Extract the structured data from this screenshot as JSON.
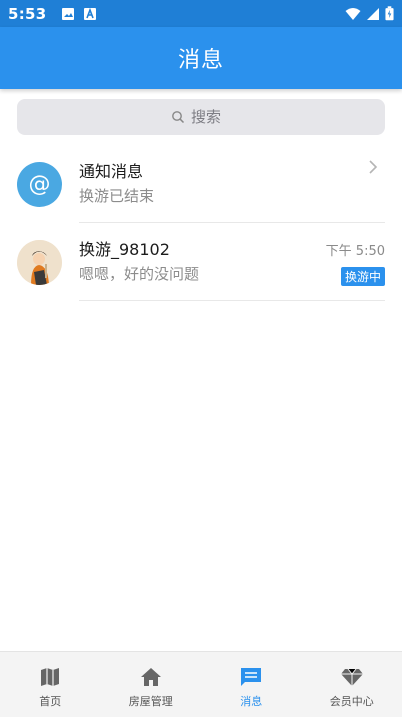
{
  "status_bar": {
    "time": "5:53"
  },
  "header": {
    "title": "消息"
  },
  "search": {
    "placeholder": "搜索"
  },
  "conversations": [
    {
      "title": "通知消息",
      "subtitle": "换游已结束",
      "avatar_icon": "at-icon"
    },
    {
      "title": "换游_98102",
      "subtitle": "嗯嗯，好的没问题",
      "time": "下午 5:50",
      "badge": "换游中",
      "avatar_icon": "user-avatar"
    }
  ],
  "bottom_nav": [
    {
      "label": "首页",
      "icon": "map-icon",
      "active": false
    },
    {
      "label": "房屋管理",
      "icon": "home-icon",
      "active": false
    },
    {
      "label": "消息",
      "icon": "message-icon",
      "active": true
    },
    {
      "label": "会员中心",
      "icon": "diamond-icon",
      "active": false
    }
  ],
  "colors": {
    "primary": "#2b91ed",
    "status_bar": "#1f7fd6",
    "badge": "#2b91ed"
  }
}
